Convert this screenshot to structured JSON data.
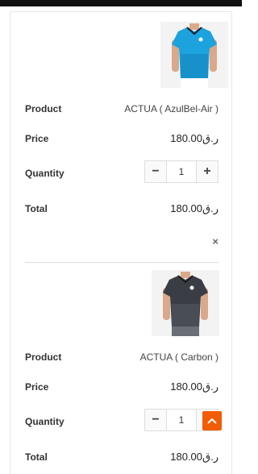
{
  "cart": {
    "labels": {
      "product": "Product",
      "price": "Price",
      "quantity": "Quantity",
      "total": "Total"
    },
    "remove_icon": "×",
    "items": [
      {
        "product_name": "ACTUA ( AzulBel-Air )",
        "price": "180.00ر.ق",
        "quantity": "1",
        "total": "180.00ر.ق",
        "image_icon": "blue-tennis-shirt-image"
      },
      {
        "product_name": "ACTUA ( Carbon )",
        "price": "180.00ر.ق",
        "quantity": "1",
        "total": "180.00ر.ق",
        "image_icon": "carbon-tennis-shirt-image"
      }
    ]
  },
  "qty_controls": {
    "minus": "−",
    "plus": "+"
  },
  "colors": {
    "accent": "#f25c05",
    "border": "#e6e6e6"
  },
  "scroll_top_icon": "chevron-up-icon"
}
